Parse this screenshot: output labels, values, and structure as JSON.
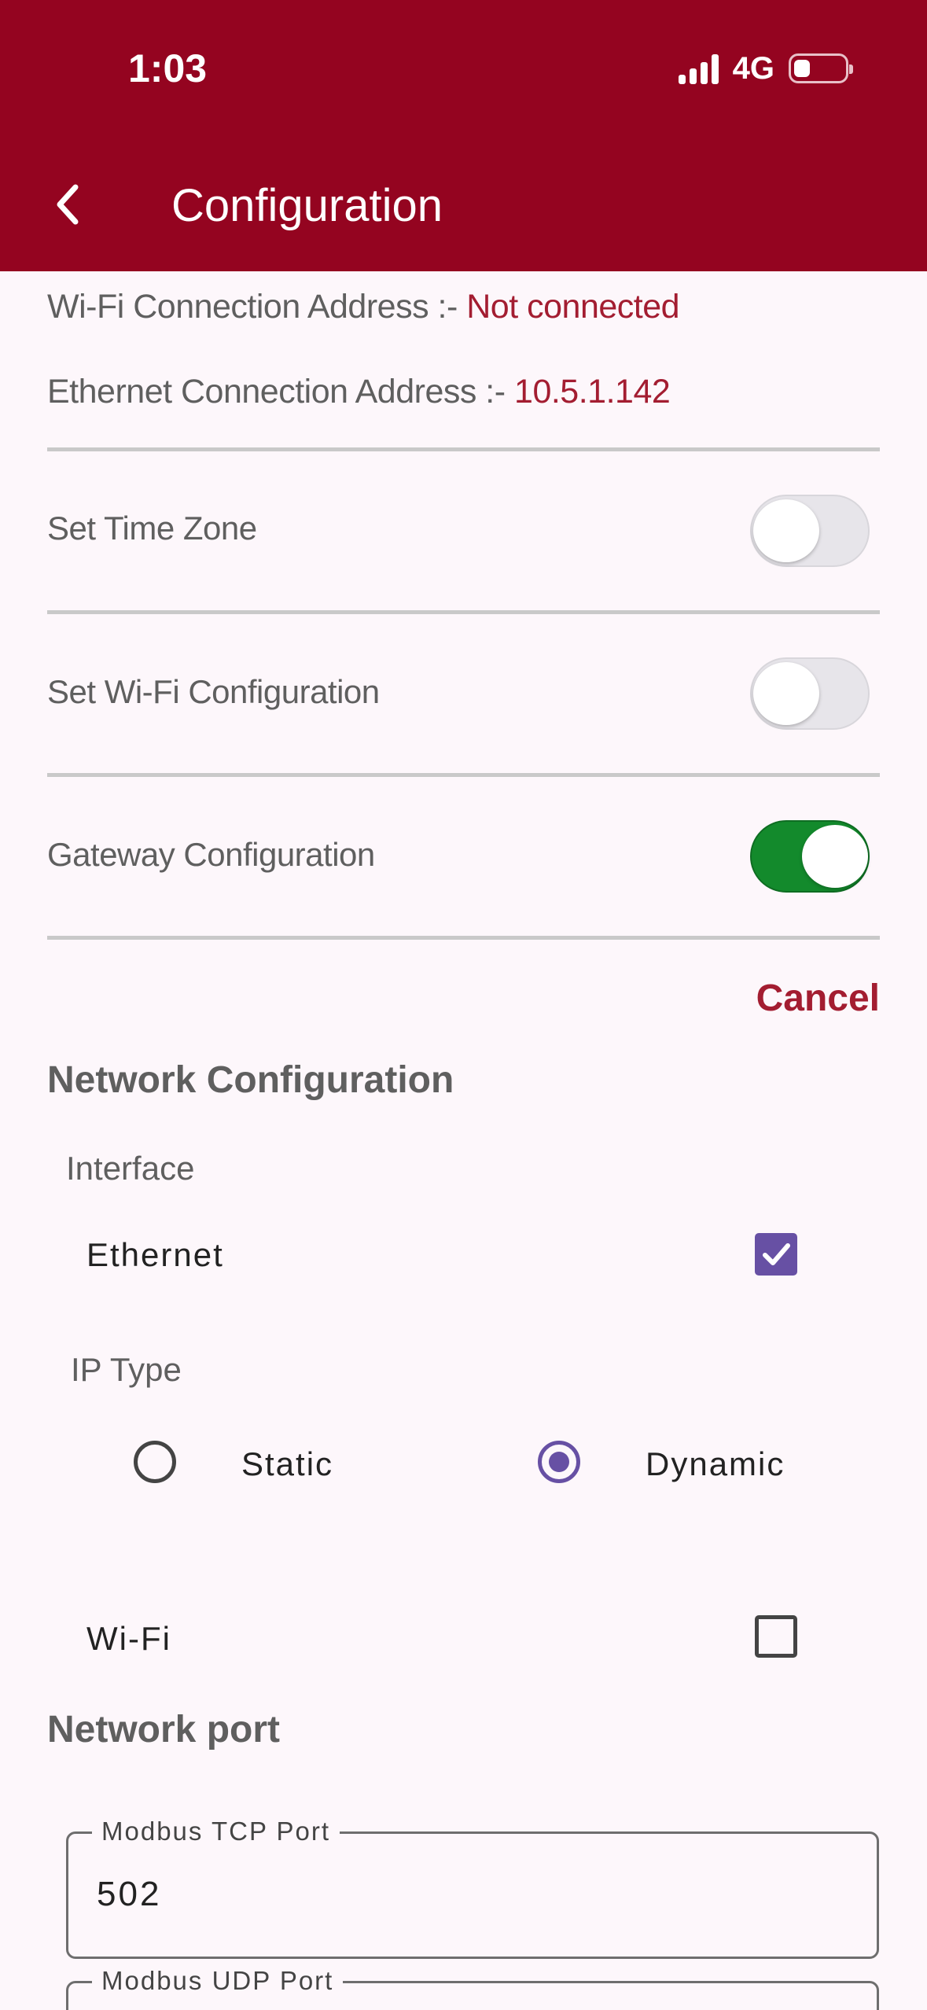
{
  "status_bar": {
    "time": "1:03",
    "network": "4G"
  },
  "header": {
    "title": "Configuration"
  },
  "connection": {
    "wifi_label": "Wi-Fi Connection Address :- ",
    "wifi_value": "Not connected",
    "ethernet_label": "Ethernet Connection Address :- ",
    "ethernet_value": "10.5.1.142"
  },
  "settings": [
    {
      "label": "Set Time Zone",
      "enabled": false
    },
    {
      "label": "Set Wi-Fi Configuration",
      "enabled": false
    },
    {
      "label": "Gateway Configuration",
      "enabled": true
    }
  ],
  "actions": {
    "cancel_label": "Cancel"
  },
  "network_configuration": {
    "title": "Network Configuration",
    "interface_label": "Interface",
    "ethernet_label": "Ethernet",
    "ethernet_checked": true,
    "ip_type_label": "IP Type",
    "ip_options": [
      {
        "label": "Static",
        "selected": false
      },
      {
        "label": "Dynamic",
        "selected": true
      }
    ],
    "wifi_label": "Wi-Fi",
    "wifi_checked": false
  },
  "network_port": {
    "title": "Network port",
    "tcp_label": "Modbus TCP Port",
    "tcp_value": "502",
    "udp_label": "Modbus UDP Port"
  },
  "colors": {
    "header_bg": "#940420",
    "accent_red": "#a31d31",
    "toggle_on": "#138a2c",
    "check_purple": "#6750a4"
  }
}
